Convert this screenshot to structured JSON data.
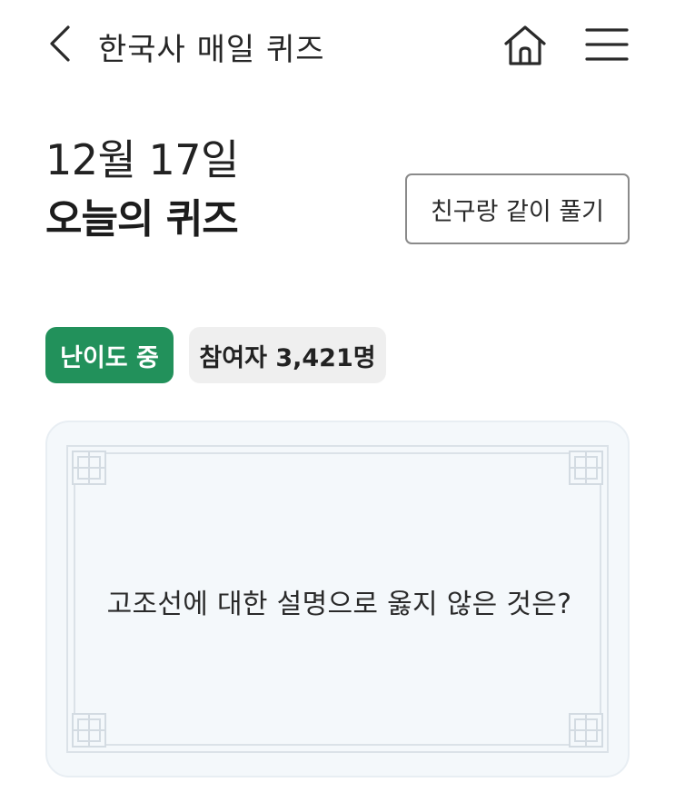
{
  "header": {
    "back_icon": "chevron-left-icon",
    "title": "한국사 매일 퀴즈",
    "home_icon": "home-icon",
    "menu_icon": "hamburger-menu-icon"
  },
  "quiz": {
    "date": "12월 17일",
    "title": "오늘의 퀴즈",
    "share_button": "친구랑 같이 풀기",
    "difficulty_badge": "난이도 중",
    "participants_badge": "참여자 3,421명",
    "question": "고조선에 대한 설명으로 옳지 않은 것은?"
  },
  "colors": {
    "accent_green": "#22915b",
    "badge_gray": "#efefef",
    "card_background": "#f4f8fb",
    "card_border": "#e8eef3",
    "frame_line": "#dbe2e8"
  }
}
